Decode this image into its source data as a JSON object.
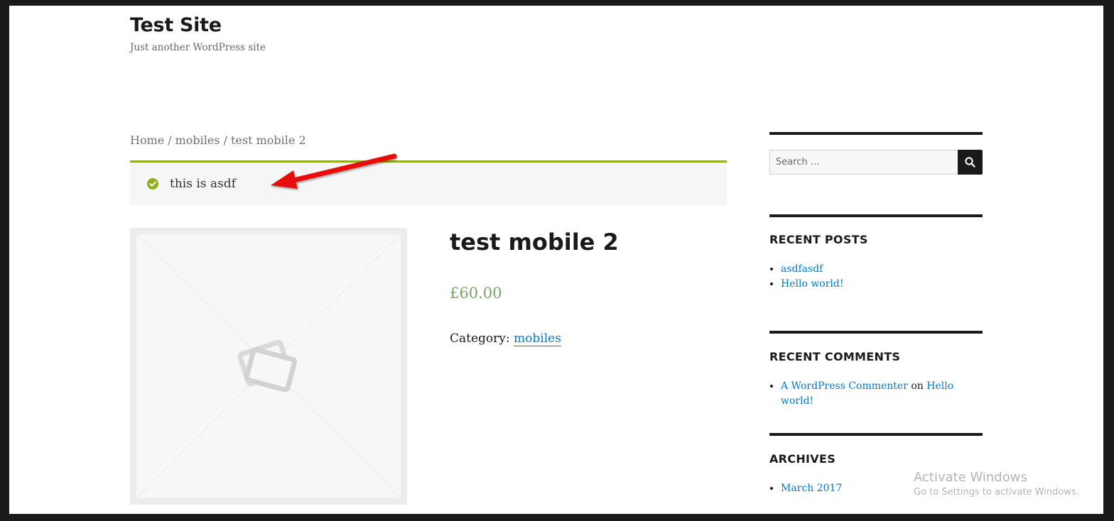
{
  "header": {
    "site_title": "Test Site",
    "site_description": "Just another WordPress site"
  },
  "breadcrumb": {
    "items": [
      "Home",
      "mobiles",
      "test mobile 2"
    ],
    "separator": "/"
  },
  "notice": {
    "message": "this is asdf",
    "color": "#8fae1b"
  },
  "annotation": {
    "arrow_color": "#e8100d"
  },
  "product": {
    "title": "test mobile 2",
    "price": "£60.00",
    "category_label": "Category:",
    "category_link": "mobiles"
  },
  "sidebar": {
    "search": {
      "placeholder": "Search …"
    },
    "recent_posts": {
      "title": "RECENT POSTS",
      "items": [
        "asdfasdf",
        "Hello world!"
      ]
    },
    "recent_comments": {
      "title": "RECENT COMMENTS",
      "author": "A WordPress Commenter",
      "connector": "on",
      "post": "Hello world!"
    },
    "archives": {
      "title": "ARCHIVES",
      "items": [
        "March 2017"
      ]
    }
  },
  "watermark": {
    "line1": "Activate Windows",
    "line2": "Go to Settings to activate Windows."
  },
  "colors": {
    "link": "#007acc",
    "price": "#77a464",
    "text": "#1a1a1a"
  },
  "icons": {
    "notice": "check-circle-icon",
    "search": "search-icon",
    "placeholder": "image-placeholder-icon"
  }
}
